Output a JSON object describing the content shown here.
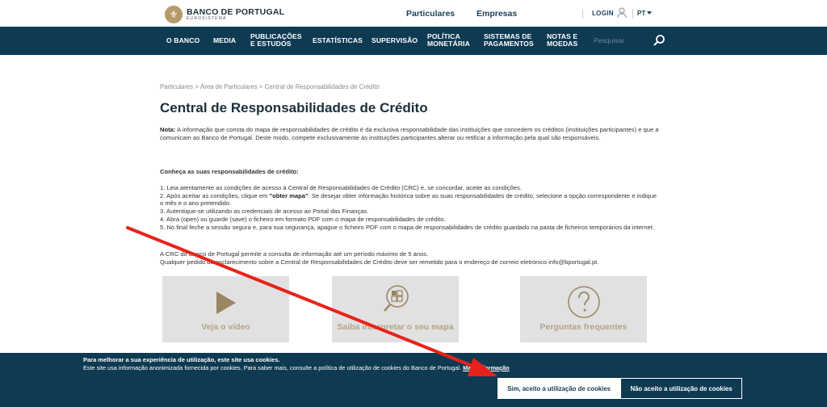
{
  "header": {
    "logo_title": "BANCO DE PORTUGAL",
    "logo_subtitle": "EUROSISTEMA",
    "tabs": [
      {
        "label": "Particulares"
      },
      {
        "label": "Empresas"
      }
    ],
    "login_label": "LOGIN",
    "language": "PT"
  },
  "nav": {
    "items": [
      {
        "label": "O BANCO"
      },
      {
        "label": "MEDIA"
      },
      {
        "label": "PUBLICAÇÕES\nE ESTUDOS"
      },
      {
        "label": "ESTATÍSTICAS"
      },
      {
        "label": "SUPERVISÃO"
      },
      {
        "label": "POLÍTICA\nMONETÁRIA"
      },
      {
        "label": "SISTEMAS DE\nPAGAMENTOS"
      },
      {
        "label": "NOTAS E\nMOEDAS"
      }
    ],
    "search_placeholder": "Pesquisar"
  },
  "content": {
    "breadcrumb": "Particulares > Área de Particulares > Central de Responsabilidades de Crédito",
    "title": "Central de Responsabilidades de Crédito",
    "note_label": "Nota:",
    "note_text": " A informação que consta do mapa de responsabilidades de crédito é da exclusiva responsabilidade das instituições que concedem os créditos (instituições participantes) e que a comunicam ao Banco de Portugal. Deste modo, compete exclusivamente às instituições participantes alterar ou retificar a informação pela qual são responsáveis.",
    "steps_heading": "Conheça as suas responsabilidades de crédito:",
    "step1": "1. Leia atentamente as condições de acesso à Central de Responsabilidades de Crédito (CRC) e, se concordar, aceite as condições.",
    "step2_a": "2. Após aceitar as condições, clique em ",
    "step2_bold": "\"obter mapa\"",
    "step2_b": ". Se desejar obter informação histórica sobre as suas responsabilidades de crédito, selecione a opção correspondente e indique o mês e o ano pretendido.",
    "step3": "3. Autentique-se utilizando as credenciais de acesso ao Portal das Finanças.",
    "step4": "4. Abra (open) ou guarde (save) o ficheiro em formato PDF com o mapa de responsabilidades de crédito.",
    "step5": "5. No final feche a sessão segura e, para sua segurança, apague o ficheiro PDF com o mapa de responsabilidades de crédito guardado na pasta de ficheiros temporários da internet.",
    "footer_line1": "A CRC do Banco de Portugal permite a consulta de informação até um período máximo de 5 anos.",
    "footer_line2": "Qualquer pedido de esclarecimento sobre a Central de Responsabilidades de Crédito deve ser remetido para o endereço de correio eletrónico info@bportugal.pt."
  },
  "tiles": [
    {
      "label": "Veja o vídeo",
      "icon": "play-icon"
    },
    {
      "label": "Saiba interpretar o seu mapa",
      "icon": "magnifier-map-icon"
    },
    {
      "label": "Perguntas frequentes",
      "icon": "question-icon"
    }
  ],
  "cookies": {
    "title": "Para melhorar a sua experiência de utilização, este site usa cookies.",
    "text": "Este site usa informação anonimizada fornecida por cookies. Para saber mais, consulte a política de utilização de cookies do Banco de Portugal. ",
    "link": "Mais informação",
    "accept": "Sim, aceito a utilização de cookies",
    "decline": "Não aceito a utilização de cookies"
  },
  "colors": {
    "nav_bg": "#0e3a52",
    "tile_bg": "#e1e1e1",
    "tile_accent": "#b4a388",
    "annotation_arrow": "#e8221b"
  }
}
